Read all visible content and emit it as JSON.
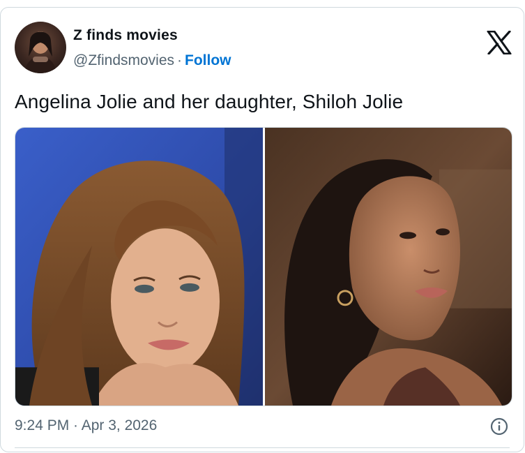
{
  "author": {
    "name": "Z finds movies",
    "handle": "@Zfindsmovies",
    "separator": "·",
    "follow_label": "Follow"
  },
  "tweet": {
    "text": "Angelina Jolie and her daughter, Shiloh Jolie",
    "timestamp": "9:24 PM · Apr 3, 2026"
  },
  "media": {
    "images": [
      {
        "icon": "portrait-photo",
        "subject": "woman with long auburn hair, blue studio background"
      },
      {
        "icon": "portrait-photo",
        "subject": "young woman with braided hair and hoop earring, warm dark background"
      }
    ]
  },
  "colors": {
    "accent": "#0074d4",
    "text_primary": "#0f1419",
    "text_secondary": "#536471",
    "border": "#cfd9de"
  },
  "icons": {
    "logo": "x-logo-icon",
    "info": "info-icon"
  }
}
